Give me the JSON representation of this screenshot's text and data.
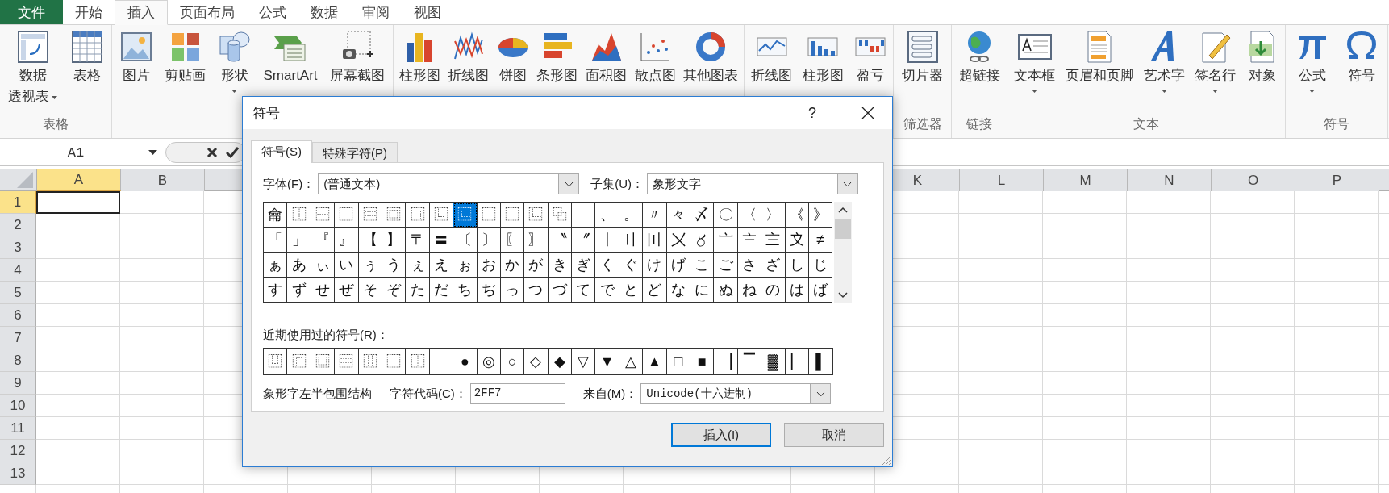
{
  "ribbon_tabs": [
    {
      "label": "文件",
      "kind": "file",
      "selected": false
    },
    {
      "label": "开始",
      "kind": "tab",
      "selected": false
    },
    {
      "label": "插入",
      "kind": "tab",
      "selected": true
    },
    {
      "label": "页面布局",
      "kind": "tab",
      "selected": false
    },
    {
      "label": "公式",
      "kind": "tab",
      "selected": false
    },
    {
      "label": "数据",
      "kind": "tab",
      "selected": false
    },
    {
      "label": "审阅",
      "kind": "tab",
      "selected": false
    },
    {
      "label": "视图",
      "kind": "tab",
      "selected": false
    }
  ],
  "ribbon_groups": [
    {
      "label": "表格",
      "items": [
        {
          "label": "数据",
          "label_2": "透视表",
          "dropdown": true
        },
        {
          "label": "表格",
          "dropdown": false
        }
      ]
    },
    {
      "items": [
        {
          "label": "图片",
          "dropdown": false
        },
        {
          "label": "剪贴画",
          "dropdown": false
        },
        {
          "label": "形状",
          "dropdown": true
        },
        {
          "label": "SmartArt",
          "dropdown": false
        },
        {
          "label": "屏幕截图",
          "dropdown": false
        }
      ]
    },
    {
      "items": [
        {
          "label": "柱形图",
          "dropdown": false
        },
        {
          "label": "折线图",
          "dropdown": false
        },
        {
          "label": "饼图",
          "dropdown": false
        },
        {
          "label": "条形图",
          "dropdown": false
        },
        {
          "label": "面积图",
          "dropdown": false
        },
        {
          "label": "散点图",
          "dropdown": false
        },
        {
          "label": "其他图表",
          "dropdown": false
        }
      ]
    },
    {
      "items": [
        {
          "label": "折线图",
          "dropdown": false
        },
        {
          "label": "柱形图",
          "dropdown": false
        },
        {
          "label": "盈亏",
          "dropdown": false
        }
      ]
    },
    {
      "label": "筛选器",
      "items": [
        {
          "label": "切片器",
          "dropdown": false
        }
      ]
    },
    {
      "label": "链接",
      "items": [
        {
          "label": "超链接",
          "dropdown": false
        }
      ]
    },
    {
      "label": "文本",
      "items": [
        {
          "label": "文本框",
          "dropdown": true
        },
        {
          "label": "页眉和页脚",
          "dropdown": false
        },
        {
          "label": "艺术字",
          "dropdown": true
        },
        {
          "label": "签名行",
          "dropdown": true
        },
        {
          "label": "对象",
          "dropdown": false
        }
      ]
    },
    {
      "label": "符号",
      "items": [
        {
          "label": "公式",
          "dropdown": true
        },
        {
          "label": "符号",
          "dropdown": false
        }
      ]
    }
  ],
  "formula_bar": {
    "name_box": "A1"
  },
  "sheet": {
    "columns_left": [
      {
        "label": "A",
        "selected": true
      },
      {
        "label": "B",
        "selected": false
      }
    ],
    "columns_right": [
      {
        "label": "K",
        "selected": false
      },
      {
        "label": "L",
        "selected": false
      },
      {
        "label": "M",
        "selected": false
      },
      {
        "label": "N",
        "selected": false
      },
      {
        "label": "O",
        "selected": false
      },
      {
        "label": "P",
        "selected": false
      }
    ],
    "rows": [
      {
        "label": "1",
        "selected": true
      },
      {
        "label": "2",
        "selected": false
      },
      {
        "label": "3",
        "selected": false
      },
      {
        "label": "4",
        "selected": false
      },
      {
        "label": "5",
        "selected": false
      },
      {
        "label": "6",
        "selected": false
      },
      {
        "label": "7",
        "selected": false
      },
      {
        "label": "8",
        "selected": false
      },
      {
        "label": "9",
        "selected": false
      },
      {
        "label": "10",
        "selected": false
      },
      {
        "label": "11",
        "selected": false
      },
      {
        "label": "12",
        "selected": false
      },
      {
        "label": "13",
        "selected": false
      }
    ]
  },
  "dialog": {
    "title": "符号",
    "help": "?",
    "tabs": [
      {
        "label": "符号(S)",
        "selected": true
      },
      {
        "label": "特殊字符(P)",
        "selected": false
      }
    ],
    "font_label": "字体(F)：",
    "font_value": "(普通文本)",
    "subset_label": "子集(U)：",
    "subset_value": "象形文字",
    "symbol_rows": [
      [
        {
          "c": "⿕",
          "selected": false
        },
        {
          "c": "⿰",
          "selected": false
        },
        {
          "c": "⿱",
          "selected": false
        },
        {
          "c": "⿲",
          "selected": false
        },
        {
          "c": "⿳",
          "selected": false
        },
        {
          "c": "⿴",
          "selected": false
        },
        {
          "c": "⿵",
          "selected": false
        },
        {
          "c": "⿶",
          "selected": false
        },
        {
          "c": "⿷",
          "selected": true
        },
        {
          "c": "⿸",
          "selected": false
        },
        {
          "c": "⿹",
          "selected": false
        },
        {
          "c": "⿺",
          "selected": false
        },
        {
          "c": "⿻",
          "selected": false
        },
        {
          "selected": false
        },
        {
          "c": "、",
          "selected": false
        },
        {
          "c": "。",
          "selected": false
        },
        {
          "c": "〃",
          "selected": false
        },
        {
          "c": "々",
          "selected": false
        },
        {
          "c": "〆",
          "selected": false
        },
        {
          "c": "〇",
          "selected": false
        },
        {
          "c": "〈",
          "selected": false
        },
        {
          "c": "〉",
          "selected": false
        },
        {
          "c": "《",
          "selected": false
        },
        {
          "c": "》",
          "selected": false
        }
      ],
      [
        {
          "c": "「",
          "selected": false
        },
        {
          "c": "」",
          "selected": false
        },
        {
          "c": "『",
          "selected": false
        },
        {
          "c": "』",
          "selected": false
        },
        {
          "c": "【",
          "selected": false
        },
        {
          "c": "】",
          "selected": false
        },
        {
          "c": "〒",
          "selected": false
        },
        {
          "c": "〓",
          "selected": false
        },
        {
          "c": "〔",
          "selected": false
        },
        {
          "c": "〕",
          "selected": false
        },
        {
          "c": "〖",
          "selected": false
        },
        {
          "c": "〗",
          "selected": false
        },
        {
          "c": "〝",
          "selected": false
        },
        {
          "c": "〞",
          "selected": false
        },
        {
          "c": "〡",
          "selected": false
        },
        {
          "c": "〢",
          "selected": false
        },
        {
          "c": "〣",
          "selected": false
        },
        {
          "c": "〤",
          "selected": false
        },
        {
          "c": "〥",
          "selected": false
        },
        {
          "c": "〦",
          "selected": false
        },
        {
          "c": "〧",
          "selected": false
        },
        {
          "c": "〨",
          "selected": false
        },
        {
          "c": "〩",
          "selected": false
        },
        {
          "c": "≠",
          "selected": false
        }
      ],
      [
        {
          "c": "ぁ",
          "selected": false
        },
        {
          "c": "あ",
          "selected": false
        },
        {
          "c": "ぃ",
          "selected": false
        },
        {
          "c": "い",
          "selected": false
        },
        {
          "c": "ぅ",
          "selected": false
        },
        {
          "c": "う",
          "selected": false
        },
        {
          "c": "ぇ",
          "selected": false
        },
        {
          "c": "え",
          "selected": false
        },
        {
          "c": "ぉ",
          "selected": false
        },
        {
          "c": "お",
          "selected": false
        },
        {
          "c": "か",
          "selected": false
        },
        {
          "c": "が",
          "selected": false
        },
        {
          "c": "き",
          "selected": false
        },
        {
          "c": "ぎ",
          "selected": false
        },
        {
          "c": "く",
          "selected": false
        },
        {
          "c": "ぐ",
          "selected": false
        },
        {
          "c": "け",
          "selected": false
        },
        {
          "c": "げ",
          "selected": false
        },
        {
          "c": "こ",
          "selected": false
        },
        {
          "c": "ご",
          "selected": false
        },
        {
          "c": "さ",
          "selected": false
        },
        {
          "c": "ざ",
          "selected": false
        },
        {
          "c": "し",
          "selected": false
        },
        {
          "c": "じ",
          "selected": false
        }
      ],
      [
        {
          "c": "す",
          "selected": false
        },
        {
          "c": "ず",
          "selected": false
        },
        {
          "c": "せ",
          "selected": false
        },
        {
          "c": "ぜ",
          "selected": false
        },
        {
          "c": "そ",
          "selected": false
        },
        {
          "c": "ぞ",
          "selected": false
        },
        {
          "c": "た",
          "selected": false
        },
        {
          "c": "だ",
          "selected": false
        },
        {
          "c": "ち",
          "selected": false
        },
        {
          "c": "ぢ",
          "selected": false
        },
        {
          "c": "っ",
          "selected": false
        },
        {
          "c": "つ",
          "selected": false
        },
        {
          "c": "づ",
          "selected": false
        },
        {
          "c": "て",
          "selected": false
        },
        {
          "c": "で",
          "selected": false
        },
        {
          "c": "と",
          "selected": false
        },
        {
          "c": "ど",
          "selected": false
        },
        {
          "c": "な",
          "selected": false
        },
        {
          "c": "に",
          "selected": false
        },
        {
          "c": "ぬ",
          "selected": false
        },
        {
          "c": "ね",
          "selected": false
        },
        {
          "c": "の",
          "selected": false
        },
        {
          "c": "は",
          "selected": false
        },
        {
          "c": "ば",
          "selected": false
        }
      ]
    ],
    "recent_label": "近期使用过的符号(R)：",
    "recent": [
      {
        "c": "⿶",
        "gap_after": false
      },
      {
        "c": "⿵",
        "gap_after": false
      },
      {
        "c": "⿴",
        "gap_after": false
      },
      {
        "c": "⿳",
        "gap_after": false
      },
      {
        "c": "⿲",
        "gap_after": false
      },
      {
        "c": "⿱",
        "gap_after": false
      },
      {
        "c": "⿰",
        "gap_after": true
      },
      {
        "c": "●",
        "gap_after": false
      },
      {
        "c": "◎",
        "gap_after": false
      },
      {
        "c": "○",
        "gap_after": false
      },
      {
        "c": "◇",
        "gap_after": false
      },
      {
        "c": "◆",
        "gap_after": false
      },
      {
        "c": "▽",
        "gap_after": false
      },
      {
        "c": "▼",
        "gap_after": false
      },
      {
        "c": "△",
        "gap_after": false
      },
      {
        "c": "▲",
        "gap_after": false
      },
      {
        "c": "□",
        "gap_after": false
      },
      {
        "c": "■",
        "gap_after": false
      },
      {
        "c": "▕",
        "gap_after": false
      },
      {
        "c": "▔",
        "gap_after": false
      },
      {
        "c": "▓",
        "gap_after": false
      },
      {
        "c": "▏",
        "gap_after": false
      },
      {
        "c": "▌",
        "gap_after": false
      }
    ],
    "char_name": "象形字左半包围结构",
    "code_label": "字符代码(C)：",
    "code_value": "2FF7",
    "from_label": "来自(M)：",
    "from_value": "Unicode(十六进制)",
    "buttons": [
      {
        "label": "插入(I)",
        "kind": "default"
      },
      {
        "label": "取消",
        "kind": "normal"
      }
    ]
  }
}
